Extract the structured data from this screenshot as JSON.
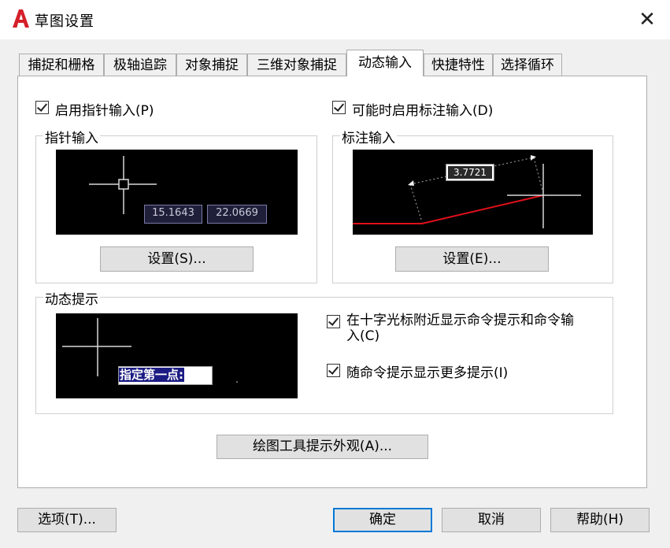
{
  "window": {
    "title": "草图设置",
    "close_glyph": "✕"
  },
  "tabs": [
    "捕捉和栅格",
    "极轴追踪",
    "对象捕捉",
    "三维对象捕捉",
    "动态输入",
    "快捷特性",
    "选择循环"
  ],
  "active_tab": "动态输入",
  "pointer_input": {
    "checkbox_label": "启用指针输入(P)",
    "checked": true,
    "group_title": "指针输入",
    "preview_values": [
      "15.1643",
      "22.0669"
    ],
    "settings_button": "设置(S)..."
  },
  "dimension_input": {
    "checkbox_label": "可能时启用标注输入(D)",
    "checked": true,
    "group_title": "标注输入",
    "preview_value": "3.7721",
    "settings_button": "设置(E)..."
  },
  "dynamic_prompts": {
    "group_title": "动态提示",
    "preview_prompt": "指定第一点:",
    "option1_line1": "在十字光标附近显示命令提示和命令输",
    "option1_line2": "入(C)",
    "option1_checked": true,
    "option2_label": "随命令提示显示更多提示(I)",
    "option2_checked": true
  },
  "appearance_button": "绘图工具提示外观(A)...",
  "footer": {
    "options_button": "选项(T)...",
    "ok_button": "确定",
    "cancel_button": "取消",
    "help_button": "帮助(H)"
  },
  "colors": {
    "accent": "#0078d7",
    "logo_red": "#d4202a",
    "dim_line_red": "#e0101a"
  }
}
